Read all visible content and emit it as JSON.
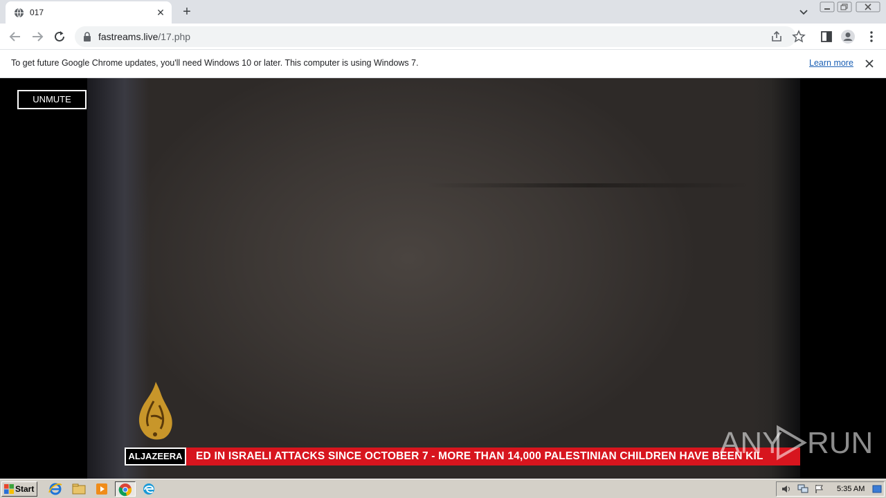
{
  "browser": {
    "tab": {
      "title": "017"
    },
    "url": {
      "host": "fastreams.live",
      "path": "/17.php"
    }
  },
  "infobar": {
    "message": "To get future Google Chrome updates, you'll need Windows 10 or later. This computer is using Windows 7.",
    "link": "Learn more"
  },
  "player": {
    "unmute_label": "UNMUTE",
    "ticker": {
      "brand": "ALJAZEERA",
      "text": "ED IN ISRAELI ATTACKS SINCE OCTOBER 7   -   MORE THAN 14,000 PALESTINIAN CHILDREN HAVE BEEN KIL"
    },
    "watermark": {
      "left": "ANY",
      "right": "RUN"
    }
  },
  "taskbar": {
    "start_label": "Start",
    "clock": "5:35 AM",
    "apps": [
      "ie-icon",
      "explorer-icon",
      "media-player-icon",
      "chrome-icon",
      "edge-icon"
    ]
  },
  "colors": {
    "tabstrip": "#dee1e6",
    "ticker_red": "#d7151e",
    "link_blue": "#1a5fb4",
    "taskbar": "#d4d0c8"
  }
}
